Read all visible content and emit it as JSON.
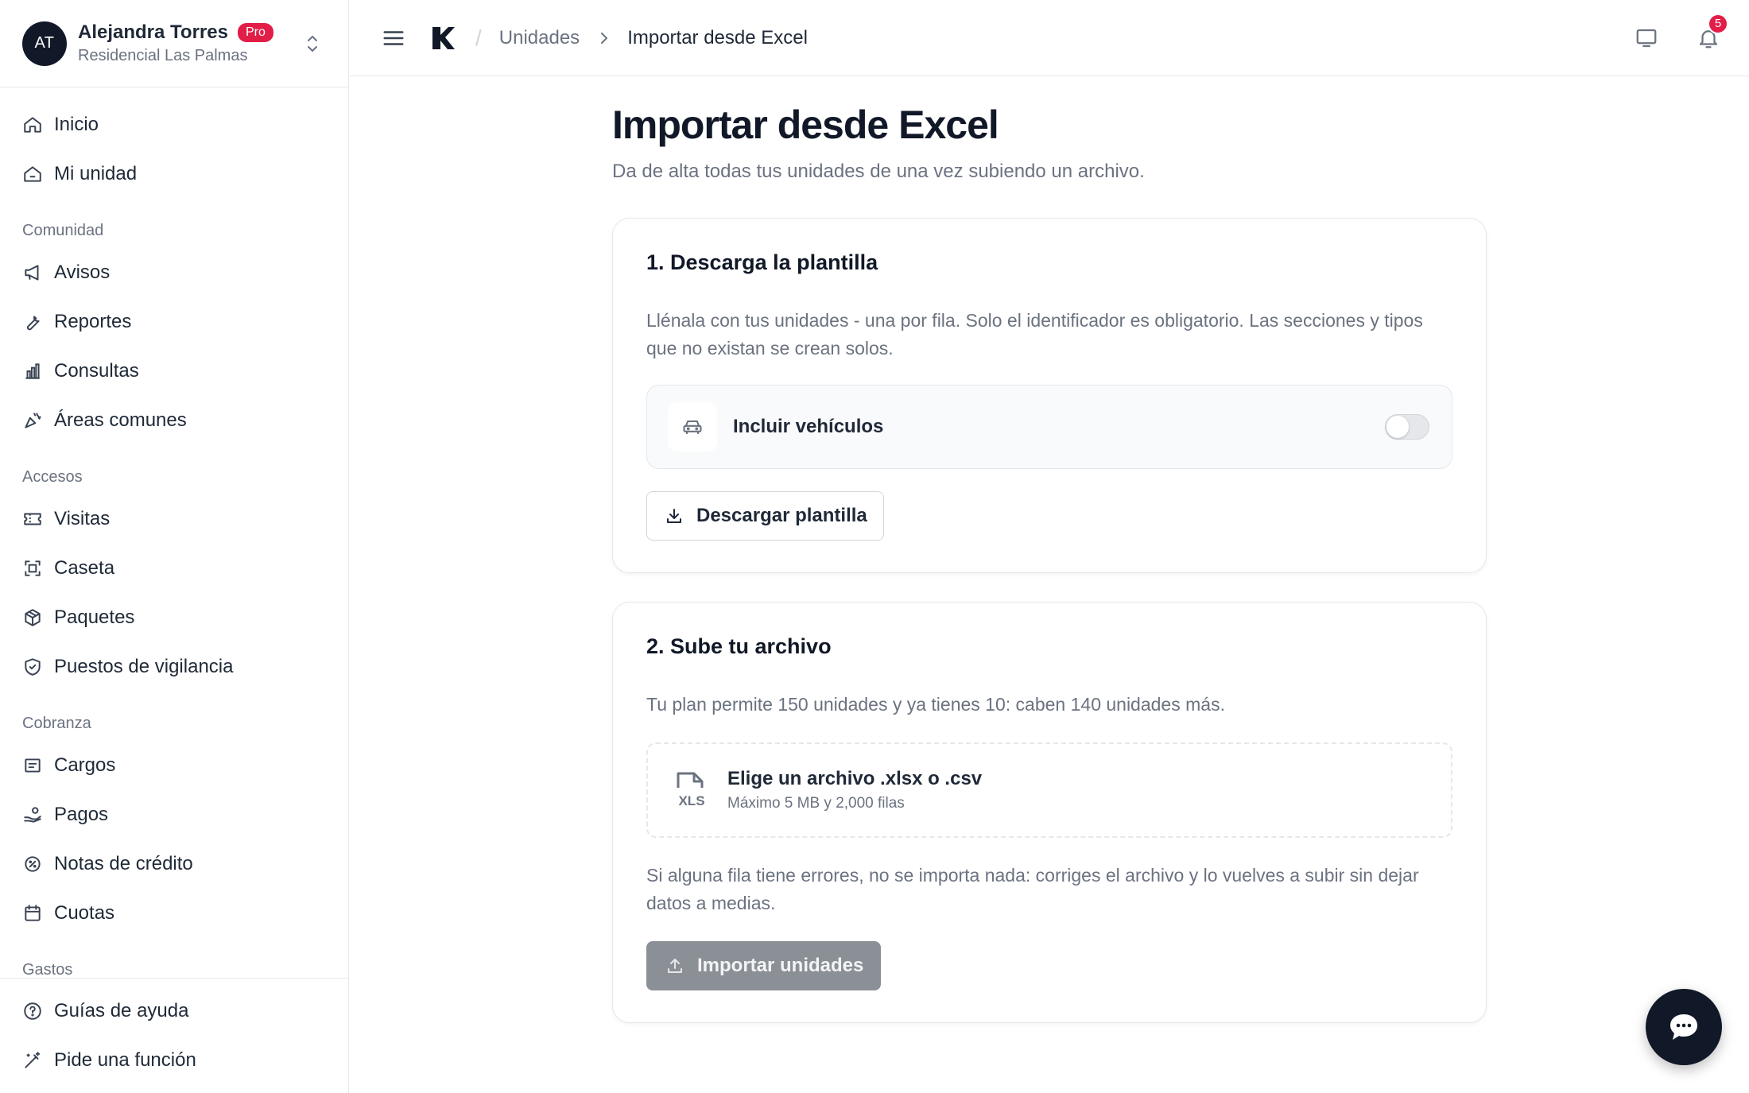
{
  "org": {
    "initials": "AT",
    "name": "Alejandra Torres",
    "badge": "Pro",
    "community": "Residencial Las Palmas"
  },
  "sidebar": {
    "inicio": "Inicio",
    "mi_unidad": "Mi unidad",
    "section_comunidad": "Comunidad",
    "avisos": "Avisos",
    "reportes": "Reportes",
    "consultas": "Consultas",
    "areas": "Áreas comunes",
    "section_accesos": "Accesos",
    "visitas": "Visitas",
    "caseta": "Caseta",
    "paquetes": "Paquetes",
    "puestos": "Puestos de vigilancia",
    "section_cobranza": "Cobranza",
    "cargos": "Cargos",
    "pagos": "Pagos",
    "notas": "Notas de crédito",
    "cuotas": "Cuotas",
    "section_gastos": "Gastos",
    "guias": "Guías de ayuda",
    "pide": "Pide una función"
  },
  "header": {
    "breadcrumb_parent": "Unidades",
    "breadcrumb_current": "Importar desde Excel",
    "notifications_count": "5"
  },
  "page": {
    "title": "Importar desde Excel",
    "subtitle": "Da de alta todas tus unidades de una vez subiendo un archivo."
  },
  "step1": {
    "title": "1. Descarga la plantilla",
    "text": "Llénala con tus unidades - una por fila. Solo el identificador es obligatorio. Las secciones y tipos que no existan se crean solos.",
    "toggle_label": "Incluir vehículos",
    "toggle_on": false,
    "button": "Descargar plantilla"
  },
  "step2": {
    "title": "2. Sube tu archivo",
    "plan_text": "Tu plan permite 150 unidades y ya tienes 10: caben 140 unidades más.",
    "dropzone_title": "Elige un archivo .xlsx o .csv",
    "dropzone_sub": "Máximo 5 MB y 2,000 filas",
    "file_type_label": "XLS",
    "warning": "Si alguna fila tiene errores, no se importa nada: corriges el archivo y lo vuelves a subir sin dejar datos a medias.",
    "button": "Importar unidades"
  },
  "colors": {
    "accent": "#e11d48",
    "dark": "#111827",
    "muted": "#6b7280",
    "disabled_button": "#8b8f96"
  }
}
